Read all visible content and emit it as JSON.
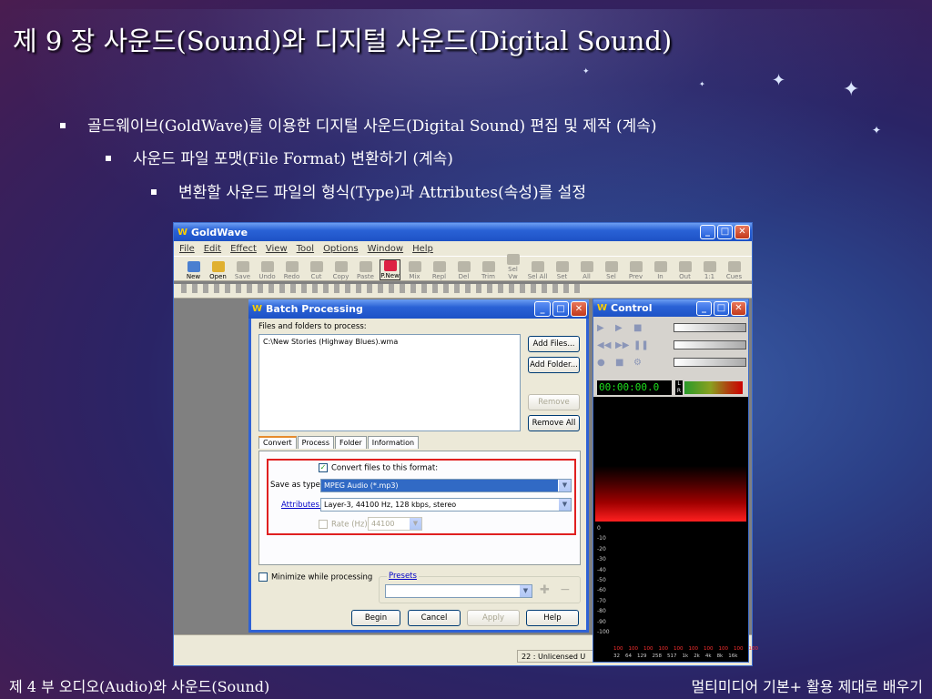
{
  "slide": {
    "title": "제 9 장 사운드(Sound)와 디지털 사운드(Digital Sound)",
    "bullets": [
      "골드웨이브(GoldWave)를 이용한 디지털 사운드(Digital Sound) 편집 및 제작 (계속)",
      "사운드 파일 포맷(File Format) 변환하기 (계속)",
      "변환할 사운드 파일의 형식(Type)과 Attributes(속성)를 설정"
    ],
    "footer_left": "제 4 부 오디오(Audio)와 사운드(Sound)",
    "footer_right": "멀티미디어 기본+ 활용 제대로 배우기"
  },
  "goldwave": {
    "title": "GoldWave",
    "app_letter": "W",
    "menu": [
      "File",
      "Edit",
      "Effect",
      "View",
      "Tool",
      "Options",
      "Window",
      "Help"
    ],
    "toolbar": [
      "New",
      "Open",
      "Save",
      "Undo",
      "Redo",
      "Cut",
      "Copy",
      "Paste",
      "P.New",
      "Mix",
      "Repl",
      "Del",
      "Trim",
      "Sel Vw",
      "Sel All",
      "Set",
      "All",
      "Sel",
      "Prev",
      "In",
      "Out",
      "1:1",
      "Cues"
    ],
    "status_text": "22 : Unlicensed U"
  },
  "control": {
    "title": "Control",
    "time": "00:00:00.0",
    "lr": [
      "L",
      "R"
    ],
    "db_scale": [
      "0",
      "-10",
      "-20",
      "-30",
      "-40",
      "-50",
      "-60",
      "-70",
      "-80",
      "-90",
      "-100"
    ],
    "freq_scale": [
      "32",
      "64",
      "129",
      "258",
      "517",
      "1k",
      "2k",
      "4k",
      "8k",
      "16k"
    ],
    "freq_red": [
      "100",
      "100",
      "100",
      "100",
      "100",
      "100",
      "100",
      "100",
      "100",
      "100"
    ]
  },
  "batch": {
    "title": "Batch Processing",
    "files_label": "Files and folders to process:",
    "file_item": "C:\\New Stories (Highway Blues).wma",
    "add_files": "Add Files...",
    "add_folder": "Add Folder...",
    "remove": "Remove",
    "remove_all": "Remove All",
    "tabs": [
      "Convert",
      "Process",
      "Folder",
      "Information"
    ],
    "convert_checkbox": "Convert files to this format:",
    "save_as_label": "Save as type:",
    "save_as_value": "MPEG Audio (*.mp3)",
    "attributes_label": "Attributes:",
    "attributes_value": "Layer-3, 44100 Hz, 128 kbps, stereo",
    "rate_label": "Rate (Hz):",
    "rate_value": "44100",
    "minimize_label": "Minimize while processing",
    "presets_label": "Presets",
    "begin": "Begin",
    "cancel": "Cancel",
    "apply": "Apply",
    "help": "Help"
  }
}
